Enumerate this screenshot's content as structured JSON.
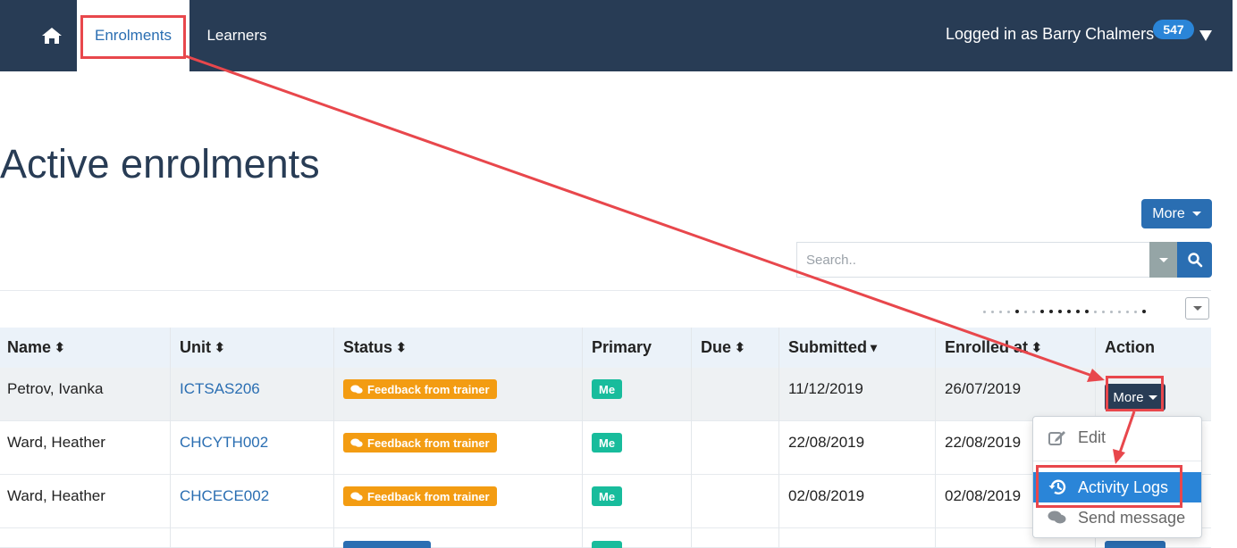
{
  "nav": {
    "home_icon": "home-icon",
    "tabs": [
      {
        "label": "Enrolments",
        "active": true
      },
      {
        "label": "Learners",
        "active": false
      }
    ],
    "user_label": "Logged in as Barry Chalmers",
    "notification_count": "547"
  },
  "page": {
    "title": "Active enrolments",
    "more_button": "More",
    "search": {
      "placeholder": "Search.."
    }
  },
  "table": {
    "columns": [
      {
        "label": "Name",
        "sort": "both"
      },
      {
        "label": "Unit",
        "sort": "both"
      },
      {
        "label": "Status",
        "sort": "both"
      },
      {
        "label": "Primary",
        "sort": "none"
      },
      {
        "label": "Due",
        "sort": "both"
      },
      {
        "label": "Submitted",
        "sort": "desc"
      },
      {
        "label": "Enrolled at",
        "sort": "both"
      },
      {
        "label": "Action",
        "sort": "none"
      }
    ],
    "rows": [
      {
        "name": "Petrov, Ivanka",
        "unit": "ICTSAS206",
        "status": "Feedback from trainer",
        "primary": "Me",
        "due": "",
        "submitted": "11/12/2019",
        "enrolled": "26/07/2019",
        "action": "More"
      },
      {
        "name": "Ward, Heather",
        "unit": "CHCYTH002",
        "status": "Feedback from trainer",
        "primary": "Me",
        "due": "",
        "submitted": "22/08/2019",
        "enrolled": "22/08/2019",
        "action": ""
      },
      {
        "name": "Ward, Heather",
        "unit": "CHCECE002",
        "status": "Feedback from trainer",
        "primary": "Me",
        "due": "",
        "submitted": "02/08/2019",
        "enrolled": "02/08/2019",
        "action": ""
      }
    ]
  },
  "action_menu": {
    "items": [
      {
        "label": "Edit",
        "icon": "edit-icon"
      },
      {
        "label": "Activity Logs",
        "icon": "history-icon",
        "highlighted": true
      },
      {
        "label": "Send message",
        "icon": "comments-icon"
      }
    ]
  },
  "colors": {
    "navbar": "#283c55",
    "primary": "#2a6eb2",
    "badge_feedback": "#f39c12",
    "badge_me": "#18bc9c",
    "annotation": "#e8474c"
  }
}
